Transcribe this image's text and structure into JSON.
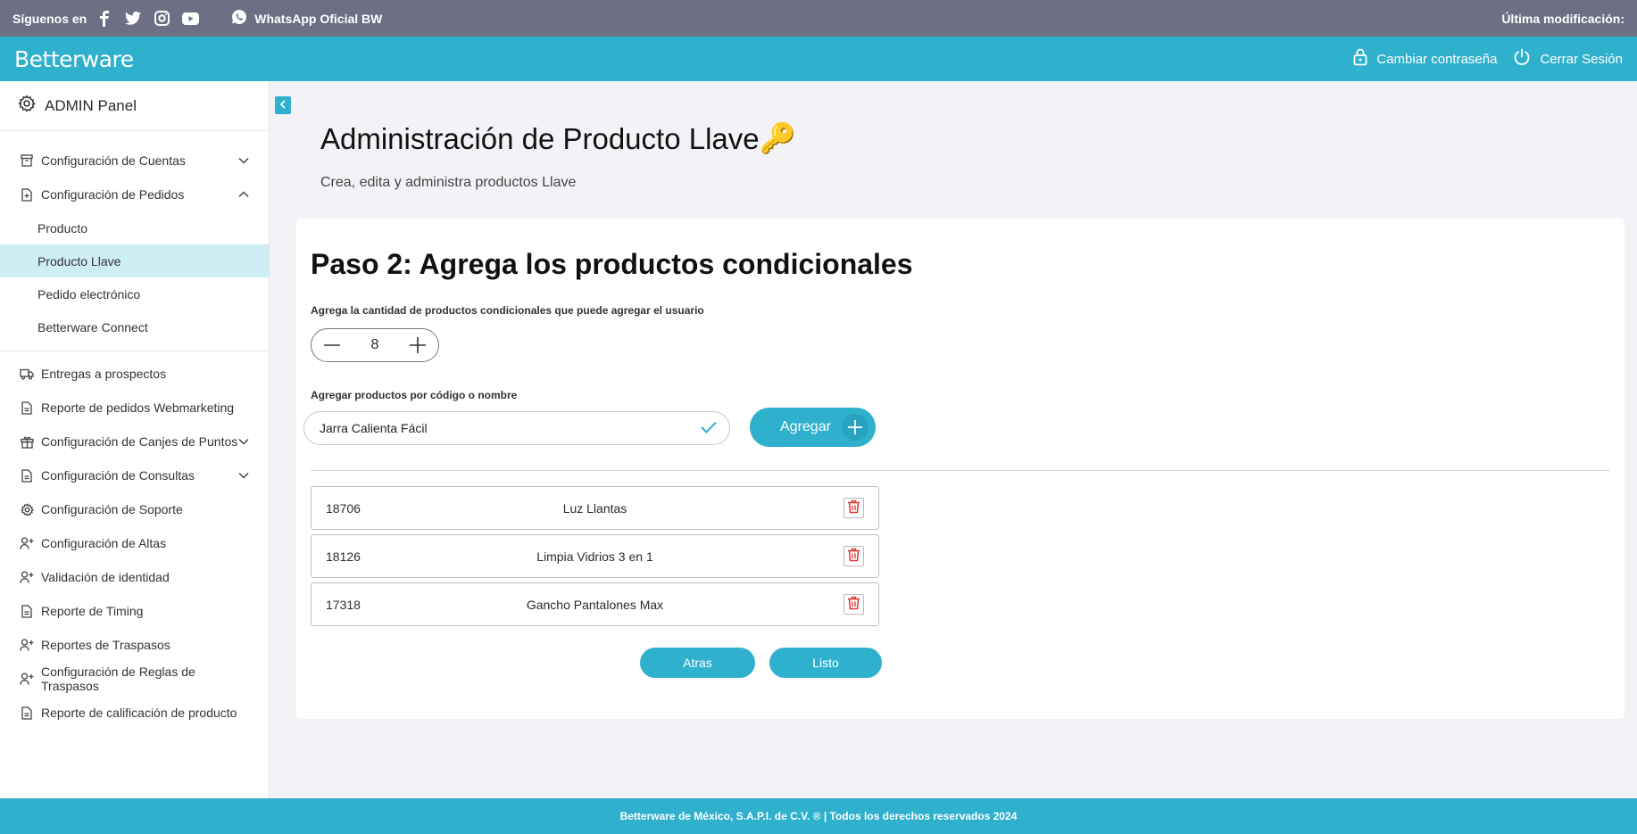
{
  "topbar": {
    "follow_label": "Síguenos en",
    "social_icons": [
      "facebook-icon",
      "twitter-icon",
      "instagram-icon",
      "youtube-icon"
    ],
    "whatsapp_label": "WhatsApp Oficial BW",
    "last_modified_label": "Última modificación:"
  },
  "header": {
    "logo_text": "Betterware",
    "change_password_label": "Cambiar contraseña",
    "logout_label": "Cerrar Sesión"
  },
  "sidebar": {
    "panel_title": "ADMIN Panel",
    "items": [
      {
        "label": "Configuración de Cuentas",
        "icon": "archive-icon",
        "expandable": true,
        "expanded": false
      },
      {
        "label": "Configuración de Pedidos",
        "icon": "document-icon",
        "expandable": true,
        "expanded": true,
        "children": [
          {
            "label": "Producto",
            "active": false
          },
          {
            "label": "Producto Llave",
            "active": true
          },
          {
            "label": "Pedido electrónico",
            "active": false
          },
          {
            "label": "Betterware Connect",
            "active": false
          }
        ]
      },
      {
        "label": "Entregas a prospectos",
        "icon": "truck-icon"
      },
      {
        "label": "Reporte de pedidos Webmarketing",
        "icon": "document-icon"
      },
      {
        "label": "Configuración de Canjes de Puntos",
        "icon": "gift-icon",
        "expandable": true
      },
      {
        "label": "Configuración de Consultas",
        "icon": "document-icon",
        "expandable": true
      },
      {
        "label": "Configuración de Soporte",
        "icon": "gear-icon"
      },
      {
        "label": "Configuración de Altas",
        "icon": "user-plus-icon"
      },
      {
        "label": "Validación de identidad",
        "icon": "user-plus-icon"
      },
      {
        "label": "Reporte de Timing",
        "icon": "document-icon"
      },
      {
        "label": "Reportes de Traspasos",
        "icon": "user-plus-icon"
      },
      {
        "label": "Configuración de Reglas de Traspasos",
        "icon": "user-plus-icon"
      },
      {
        "label": "Reporte de calificación de producto",
        "icon": "document-icon"
      }
    ]
  },
  "main": {
    "title": "Administración de Producto Llave",
    "title_emoji": "🔑",
    "subtitle": "Crea, edita y administra productos Llave",
    "step_title": "Paso 2: Agrega los productos condicionales",
    "quantity_label": "Agrega la cantidad de productos condicionales que puede agregar el usuario",
    "quantity_value": "8",
    "search_label": "Agregar productos por código o nombre",
    "search_value": "Jarra Calienta Fácil",
    "add_button_label": "Agregar",
    "products": [
      {
        "code": "18706",
        "name": "Luz Llantas"
      },
      {
        "code": "18126",
        "name": "Limpia Vidrios 3 en 1"
      },
      {
        "code": "17318",
        "name": "Gancho Pantalones Max"
      }
    ],
    "back_button_label": "Atras",
    "done_button_label": "Listo"
  },
  "footer": {
    "text": "Betterware de México, S.A.P.I. de C.V. ® | Todos los derechos reservados 2024"
  },
  "colors": {
    "brand": "#2fb0cd",
    "topstrip": "#6d6f84",
    "active_item": "#cdeef4",
    "delete": "#e0342f"
  }
}
